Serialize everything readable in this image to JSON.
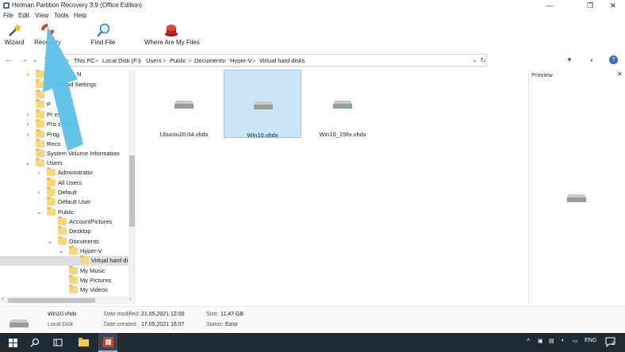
{
  "window": {
    "title": "Hetman Partition Recovery 3.9 (Office Edition)",
    "minimize_glyph": "—",
    "maximize_glyph": "❐",
    "close_glyph": "✕"
  },
  "menu": {
    "file": "File",
    "edit": "Edit",
    "view": "View",
    "tools": "Tools",
    "help": "Help"
  },
  "toolbar": {
    "wizard": "Wizard",
    "recovery": "Recovery",
    "find_file": "Find File",
    "where_are_my_files": "Where Are My Files"
  },
  "address": {
    "back": "←",
    "forward": "→",
    "history": "⌄",
    "up": "↑",
    "crumbs": [
      "This PC",
      "Local Disk (F:)",
      "Users",
      "Public",
      "Documents",
      "Hyper-V",
      "Virtual hard disks"
    ],
    "separator": ">",
    "dropdown": "⌄",
    "refresh": "↻"
  },
  "right_tools": {
    "filter": "▼",
    "view": "▪",
    "help": "?"
  },
  "tree": {
    "items": [
      {
        "label": "$WINNT.~BT",
        "visible_label": "N"
      },
      {
        "label": "Documents and Settings",
        "visible_label": "ts and Settings"
      },
      {
        "label": ""
      },
      {
        "label": ""
      },
      {
        "label": "Program Files",
        "visible_label": "Pr      es"
      },
      {
        "label": "Program Files (x86)",
        "visible_label": "Pro      s (x86)"
      },
      {
        "label": "ProgramData",
        "visible_label": "Prog"
      },
      {
        "label": "Recovery",
        "visible_label": "Reco"
      },
      {
        "label": "System Volume Information"
      },
      {
        "label": "Users"
      },
      {
        "label": "Administrator"
      },
      {
        "label": "All Users"
      },
      {
        "label": "Default"
      },
      {
        "label": "Default User"
      },
      {
        "label": "Public"
      },
      {
        "label": "AccountPictures"
      },
      {
        "label": "Desktop"
      },
      {
        "label": "Documents"
      },
      {
        "label": "Hyper-V"
      },
      {
        "label": "Virtual hard di"
      },
      {
        "label": "My Music"
      },
      {
        "label": "My Pictures"
      },
      {
        "label": "My Videos"
      }
    ]
  },
  "files": [
    {
      "name": "Ubuntu20.04.vhdx",
      "selected": false
    },
    {
      "name": "Win10.vhdx",
      "selected": true
    },
    {
      "name": "Win10_15fix.vhdx",
      "selected": false
    }
  ],
  "preview": {
    "title": "Preview",
    "close": "✕"
  },
  "status": {
    "file_name": "Win10.vhdx",
    "location": "Local Disk",
    "date_modified_label": "Date modified:",
    "date_modified": "21.05.2021 12:00",
    "date_created_label": "Date created:",
    "date_created": "17.05.2021 16:07",
    "size_label": "Size:",
    "size": "11,47 GB",
    "status_label": "Status:",
    "status": "Exist"
  },
  "taskbar": {
    "tray_lang": "ENG",
    "notifications": "2"
  },
  "colors": {
    "selection": "#cce4f7",
    "folder": "#f8d775",
    "arrow": "#5bc0e8",
    "taskbar": "#1f2a33"
  }
}
